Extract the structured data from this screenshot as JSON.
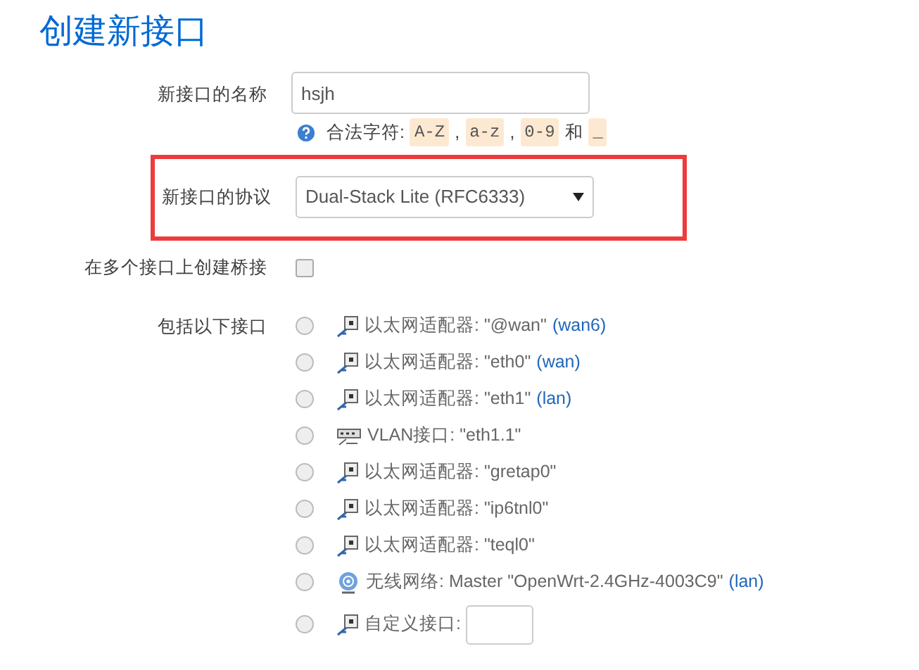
{
  "title": "创建新接口",
  "name_field": {
    "label": "新接口的名称",
    "value": "hsjh",
    "hint": {
      "text": "合法字符:",
      "parts": [
        {
          "kind": "code",
          "text": "A-Z"
        },
        {
          "kind": "text",
          "text": ","
        },
        {
          "kind": "code",
          "text": "a-z"
        },
        {
          "kind": "text",
          "text": ","
        },
        {
          "kind": "code",
          "text": "0-9"
        },
        {
          "kind": "text",
          "text": "和"
        },
        {
          "kind": "code",
          "text": "_"
        }
      ]
    }
  },
  "protocol_field": {
    "label": "新接口的协议",
    "value": "Dual-Stack Lite (RFC6333)",
    "highlighted": true
  },
  "bridge": {
    "label": "在多个接口上创建桥接",
    "checked": false
  },
  "interfaces": {
    "label": "包括以下接口",
    "items": [
      {
        "kind": "ethernet",
        "text": "以太网适配器: \"@wan\"",
        "network": "(wan6)",
        "selected": false
      },
      {
        "kind": "ethernet",
        "text": "以太网适配器: \"eth0\"",
        "network": "(wan)",
        "selected": false
      },
      {
        "kind": "ethernet",
        "text": "以太网适配器: \"eth1\"",
        "network": "(lan)",
        "selected": false
      },
      {
        "kind": "vlan",
        "text": "VLAN接口: \"eth1.1\"",
        "selected": false
      },
      {
        "kind": "ethernet",
        "text": "以太网适配器: \"gretap0\"",
        "selected": false
      },
      {
        "kind": "ethernet",
        "text": "以太网适配器: \"ip6tnl0\"",
        "selected": false
      },
      {
        "kind": "ethernet",
        "text": "以太网适配器: \"teql0\"",
        "selected": false
      },
      {
        "kind": "wireless",
        "text": "无线网络: Master \"OpenWrt-2.4GHz-4003C9\"",
        "network": "(lan)",
        "selected": false
      },
      {
        "kind": "custom",
        "text": "自定义接口:",
        "selected": false
      }
    ]
  }
}
